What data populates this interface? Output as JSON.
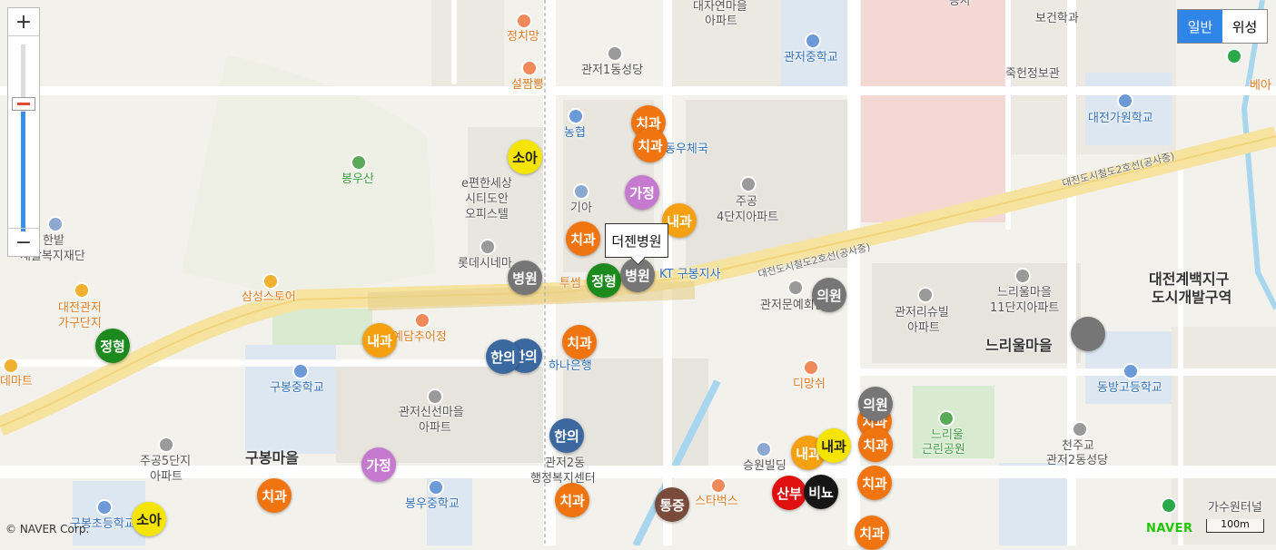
{
  "map_type": {
    "normal_label": "일반",
    "satellite_label": "위성",
    "active": "일반"
  },
  "zoom": {
    "plus_label": "+",
    "minus_label": "−",
    "level_fraction": 0.64
  },
  "tooltip": {
    "text": "더젠병원"
  },
  "copyright": "© NAVER Corp.",
  "brand": "NAVER",
  "scale": "100m",
  "places": {
    "jeongchimang": "정치망",
    "seoljjamppong": "설짬뽕",
    "gwanjeo1dong_church": "관저1동성당",
    "daejayeon": "대자연마을",
    "daejayeon_apt": "아파트",
    "gwanjeo_middle": "관저중학교",
    "nonghyup": "농협",
    "bongusan": "봉우산",
    "epyeonhan1": "e편한세상",
    "epyeonhan2": "시티도안",
    "epyeonhan3": "오피스텔",
    "gia": "기아",
    "post_office": "동우체국",
    "jugong4_1": "주공",
    "jugong4_2": "4단지아파트",
    "lotte_cinema": "롯데시네마",
    "kt": "KT 구봉지사",
    "hanbat1": "한밭",
    "hanbat2": "재활복지재단",
    "samsung_store": "삼성스토어",
    "gagu1": "대전관저",
    "gagu2": "가구단지",
    "tuseom": "투썸",
    "yedam": "예담추어정",
    "gwanjeo_munhwa": "관저문예회관",
    "riswill1": "관저리슈빌",
    "riswill2": "아파트",
    "neuriul11_1": "느리울마을",
    "neuriul11_2": "11단지아파트",
    "neuriul": "느리울마을",
    "dongbang": "동방고등학교",
    "gubong_middle": "구봉중학교",
    "hana_bank": "하나은행",
    "dimangshi": "디망쉬",
    "gwanjeosinseon1": "관저신선마을",
    "gwanjeosinseon2": "아파트",
    "neuriul_park1": "느리울",
    "neuriul_park2": "근린공원",
    "cheonju1": "천주교",
    "cheonju2": "관저2동성당",
    "jugong5_1": "주공5단지",
    "jugong5_2": "아파트",
    "gubong_village": "구봉마을",
    "gwanjeo2_1": "관저2동",
    "gwanjeo2_2": "행정복지센터",
    "seungwon": "승원빌딩",
    "starbucks": "스타벅스",
    "bongu_middle": "봉우중학교",
    "goodong_elem": "구봉초등학교",
    "gasuwon_tunnel": "가수원터널",
    "emart": "데마트",
    "bogeon": "보건학과",
    "jukheon": "죽헌정보관",
    "daejeon_gawon": "대전가원학교",
    "baekje1": "대전계백지구",
    "baekje2": "도시개발구역",
    "beta": "베아",
    "gongsa": "공사",
    "road1": "대전도시철도2호선(공사중)",
    "road2": "대전도시철도2호선(공사중)"
  },
  "markers": [
    {
      "label": "소아",
      "color": "#f5e400",
      "text_color": "#222"
    },
    {
      "label": "치과",
      "color": "#f07410"
    },
    {
      "label": "치과",
      "color": "#f07410"
    },
    {
      "label": "가정",
      "color": "#c57ad0"
    },
    {
      "label": "내과",
      "color": "#f5a010"
    },
    {
      "label": "치과",
      "color": "#f07410"
    },
    {
      "label": "병원",
      "color": "#767676"
    },
    {
      "label": "정형",
      "color": "#1c8a1c"
    },
    {
      "label": "병원",
      "color": "#767676"
    },
    {
      "label": "의원",
      "color": "#767676"
    },
    {
      "label": "정형",
      "color": "#1c8a1c"
    },
    {
      "label": "내과",
      "color": "#f5a010"
    },
    {
      "label": "한의",
      "color": "#3c68a0"
    },
    {
      "label": "한의",
      "color": "#3c68a0"
    },
    {
      "label": "치과",
      "color": "#f07410"
    },
    {
      "label": "한의",
      "color": "#3c68a0"
    },
    {
      "label": "가정",
      "color": "#c57ad0"
    },
    {
      "label": "치과",
      "color": "#f07410"
    },
    {
      "label": "치과",
      "color": "#f07410"
    },
    {
      "label": "통증",
      "color": "#7a4a3a"
    },
    {
      "label": "산부",
      "color": "#e01010"
    },
    {
      "label": "비뇨",
      "color": "#161616"
    },
    {
      "label": "내과",
      "color": "#f5a010"
    },
    {
      "label": "내과",
      "color": "#f5e400",
      "text_color": "#222"
    },
    {
      "label": "치과",
      "color": "#f07410"
    },
    {
      "label": "치과",
      "color": "#f07410"
    },
    {
      "label": "치과",
      "color": "#f07410"
    },
    {
      "label": "의원",
      "color": "#767676"
    },
    {
      "label": "치과",
      "color": "#f07410"
    },
    {
      "label": "소아",
      "color": "#f5e400",
      "text_color": "#222"
    },
    {
      "label": "",
      "color": "#767676"
    }
  ]
}
